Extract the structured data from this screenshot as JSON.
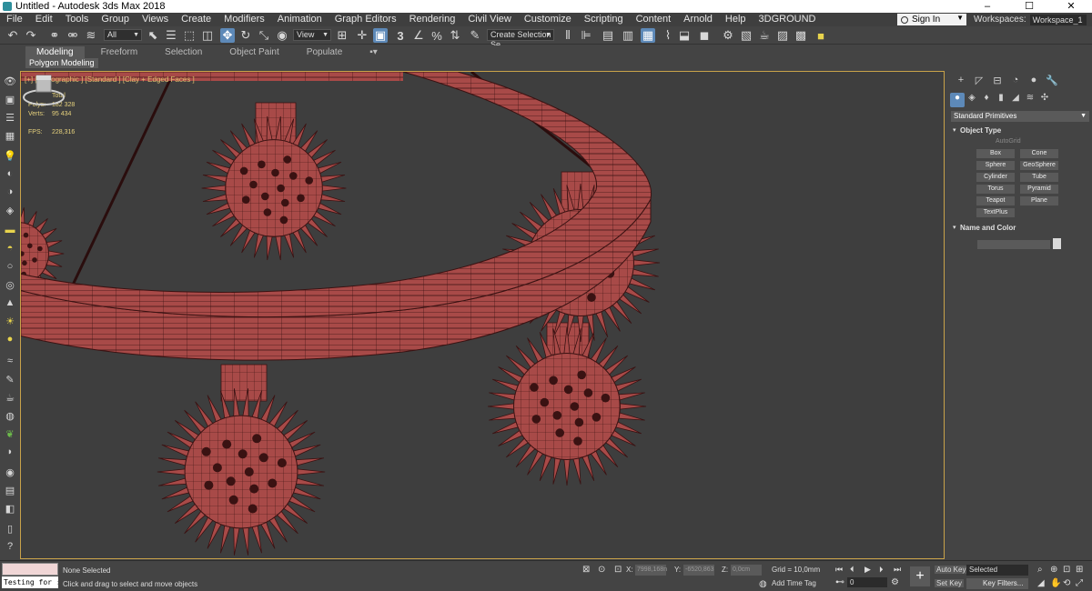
{
  "titlebar": {
    "title": "Untitled - Autodesk 3ds Max 2018",
    "minimize": "–",
    "maximize": "☐",
    "close": "✕"
  },
  "menu": [
    "File",
    "Edit",
    "Tools",
    "Group",
    "Views",
    "Create",
    "Modifiers",
    "Animation",
    "Graph Editors",
    "Rendering",
    "Civil View",
    "Customize",
    "Scripting",
    "Content",
    "Arnold",
    "Help",
    "3DGROUND"
  ],
  "account": {
    "signin": "Sign In",
    "workspaces_label": "Workspaces:",
    "workspace": "Workspace_1"
  },
  "toolbar": {
    "filter": "All",
    "ref_coord": "View",
    "selection_set": "Create Selection Se",
    "snap_value": "3"
  },
  "ribbon": {
    "tabs": [
      "Modeling",
      "Freeform",
      "Selection",
      "Object Paint",
      "Populate"
    ],
    "active_tab": "Modeling",
    "sub": "Polygon Modeling"
  },
  "viewport": {
    "label": "[+] [Orthographic ] [Standard ] [Clay + Edged Faces ]",
    "stats": {
      "total_label": "Total",
      "polys_label": "Polys:",
      "polys": "182 328",
      "verts_label": "Verts:",
      "verts": "95 434",
      "fps_label": "FPS:",
      "fps": "228,316"
    },
    "mesh_color": "#a84a48",
    "wire_color": "#3a1212",
    "bg_color": "#3e3e3e"
  },
  "command_panel": {
    "category": "Standard Primitives",
    "object_type": "Object Type",
    "autogrid": "AutoGrid",
    "buttons": [
      "Box",
      "Cone",
      "Sphere",
      "GeoSphere",
      "Cylinder",
      "Tube",
      "Torus",
      "Pyramid",
      "Teapot",
      "Plane",
      "TextPlus"
    ],
    "name_and_color": "Name and Color"
  },
  "status": {
    "script_input": "Testing for :",
    "selection": "None Selected",
    "prompt": "Click and drag to select and move objects",
    "x_label": "X:",
    "x": "7998,168n",
    "y_label": "Y:",
    "y": "-6520,863",
    "z_label": "Z:",
    "z": "0,0cm",
    "grid": "Grid = 10,0mm",
    "time_tag": "Add Time Tag",
    "frame": "0",
    "auto_key": "Auto Key",
    "set_key": "Set Key",
    "selected": "Selected",
    "key_filters": "Key Filters..."
  }
}
